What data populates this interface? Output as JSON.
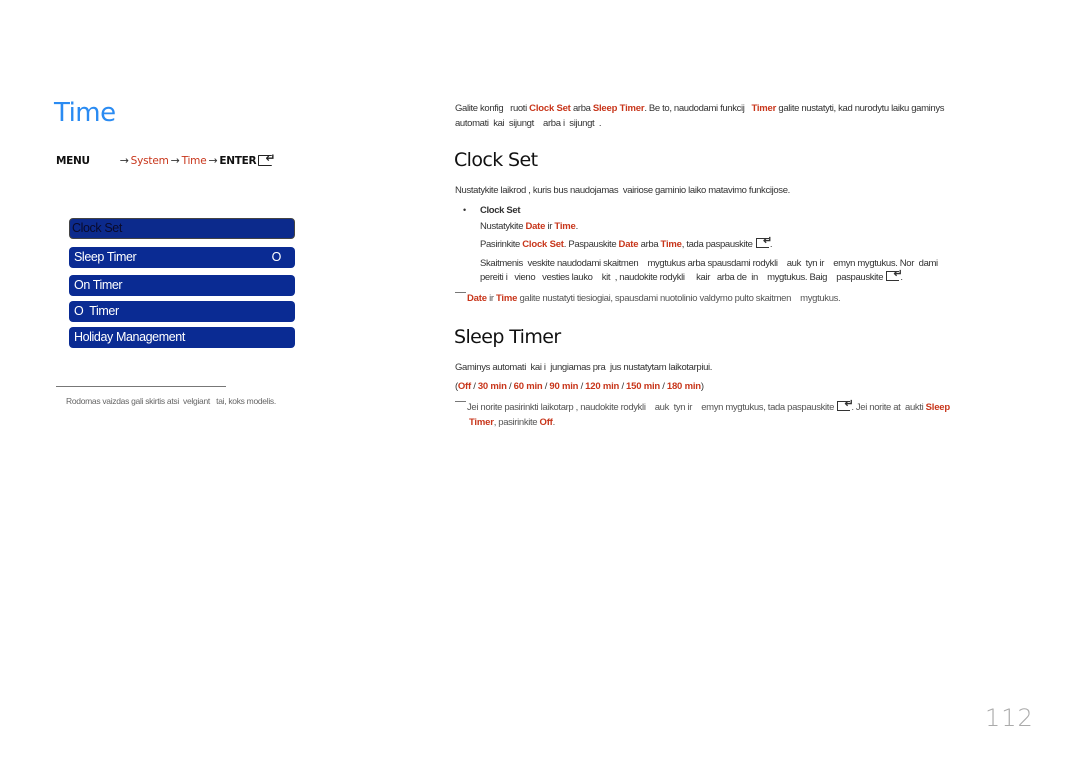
{
  "page": {
    "title": "Time",
    "page_number": "112"
  },
  "menu_path": {
    "menu": "MENU",
    "arrow": "→",
    "system": "System",
    "time": "Time",
    "enter": "ENTER",
    "enter_icon": "enter-key-icon"
  },
  "osd_menu": {
    "items": [
      {
        "label": "Clock Set",
        "value": "",
        "selected": true
      },
      {
        "label": "Sleep Timer",
        "value": "O",
        "selected": false
      },
      {
        "label": "On Timer",
        "value": "",
        "selected": false
      },
      {
        "label": "O  Timer",
        "value": "",
        "selected": false
      },
      {
        "label": "Holiday Management",
        "value": "",
        "selected": false
      }
    ]
  },
  "footnote": "Rodomas vaizdas gali skirtis atsi  velgiant   tai, koks modelis.",
  "intro": {
    "p1_a": "Galite konfig   ruoti ",
    "p1_hl1": "Clock Set",
    "p1_b": " arba ",
    "p1_hl2": "Sleep Timer",
    "p1_c": ". Be to, naudodami funkcij   ",
    "p1_hl3": "Timer",
    "p1_d": " galite nustatyti, kad nurodytu laiku gaminys",
    "p2": "automati  kai  sijungt    arba i  sijungt  ."
  },
  "clock_set": {
    "heading": "Clock Set",
    "description": "Nustatykite laikrod , kuris bus naudojamas  vairiose gaminio laiko matavimo funkcijose.",
    "bullet": "•",
    "item_title": "Clock Set",
    "line1_a": "Nustatykite ",
    "line1_hl1": "Date",
    "line1_b": " ir ",
    "line1_hl2": "Time",
    "line1_c": ".",
    "line2_a": "Pasirinkite ",
    "line2_hl1": "Clock Set",
    "line2_b": ". Paspauskite ",
    "line2_hl2": "Date",
    "line2_c": " arba ",
    "line2_hl3": "Time",
    "line2_d": ", tada paspauskite ",
    "line2_e": ".",
    "line3": "Skaitmenis  veskite naudodami skaitmen    mygtukus arba spausdami rodykli    auk  tyn ir    emyn mygtukus. Nor  dami",
    "line4_a": "pereiti i   vieno   vesties lauko    kit  , naudokite rodykli     kair   arba de  in    mygtukus. Baig    paspauskite ",
    "line4_b": ".",
    "note_hl1": "Date",
    "note_a": " ir ",
    "note_hl2": "Time",
    "note_b": " galite nustatyti tiesiogiai, spausdami nuotolinio valdymo pulto skaitmen    mygtukus."
  },
  "sleep_timer": {
    "heading": "Sleep Timer",
    "description": "Gaminys automati  kai i  jungiamas pra  jus nustatytam laikotarpiui.",
    "options_open": "(",
    "options": [
      "Off",
      "30 min",
      "60 min",
      "90 min",
      "120 min",
      "150 min",
      "180 min"
    ],
    "options_sep": " / ",
    "options_close": ")",
    "note_a": "Jei norite pasirinkti laikotarp , naudokite rodykli    auk  tyn ir    emyn mygtukus, tada paspauskite ",
    "note_b": ". Jei norite at  aukti ",
    "note_hl1": "Sleep",
    "note_hl2": "Timer",
    "note_c": ", pasirinkite ",
    "note_hl3": "Off",
    "note_d": "."
  }
}
